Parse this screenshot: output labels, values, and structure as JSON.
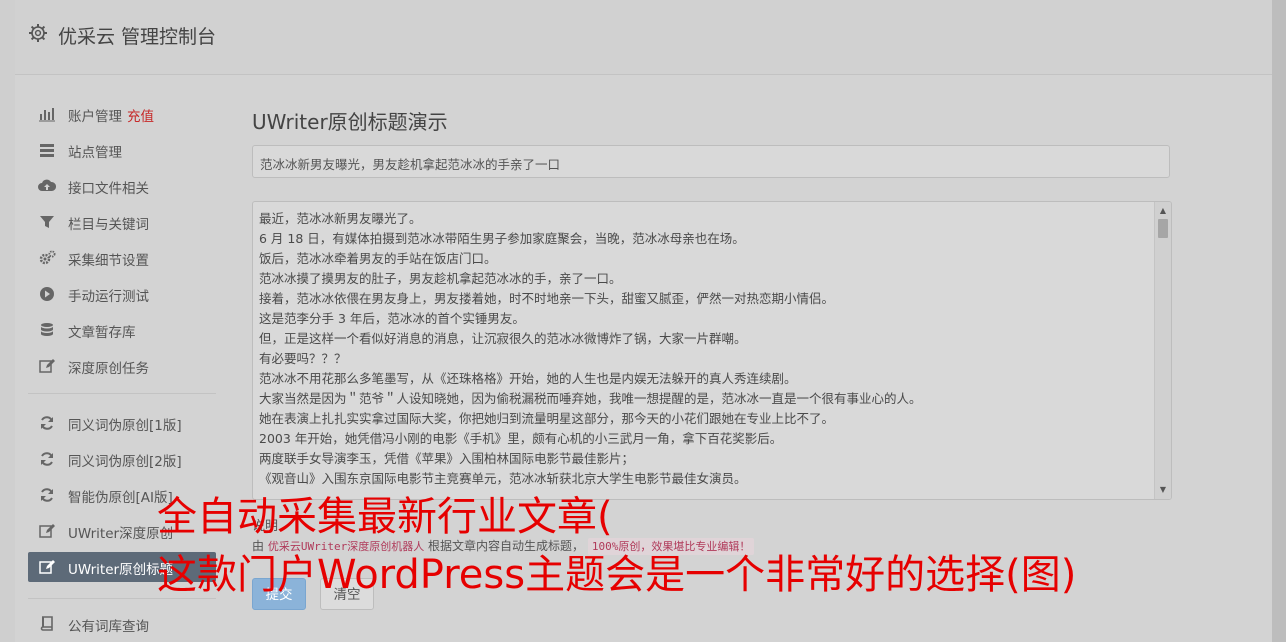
{
  "header": {
    "title": "优采云 管理控制台",
    "icon": "gear-icon"
  },
  "sidebar": {
    "items": [
      {
        "label": "账户管理",
        "extra": "充值",
        "icon": "bar-chart-icon"
      },
      {
        "label": "站点管理",
        "icon": "server-icon"
      },
      {
        "label": "接口文件相关",
        "icon": "cloud-upload-icon"
      },
      {
        "label": "栏目与关键词",
        "icon": "filter-icon"
      },
      {
        "label": "采集细节设置",
        "icon": "gears-icon"
      },
      {
        "label": "手动运行测试",
        "icon": "play-circle-icon"
      },
      {
        "label": "文章暂存库",
        "icon": "database-icon"
      },
      {
        "label": "深度原创任务",
        "icon": "edit-icon"
      },
      {
        "label": "同义词伪原创[1版]",
        "icon": "refresh-icon"
      },
      {
        "label": "同义词伪原创[2版]",
        "icon": "refresh-icon"
      },
      {
        "label": "智能伪原创[AI版]",
        "icon": "refresh-icon"
      },
      {
        "label": "UWriter深度原创",
        "icon": "edit-icon"
      },
      {
        "label": "UWriter原创标题",
        "icon": "edit-icon",
        "active": true
      },
      {
        "label": "公有词库查询",
        "icon": "book-icon"
      }
    ]
  },
  "main": {
    "title": "UWriter原创标题演示",
    "title_input_value": "范冰冰新男友曝光，男友趁机拿起范冰冰的手亲了一口",
    "content_lines": [
      "最近，范冰冰新男友曝光了。",
      "6 月 18 日，有媒体拍摄到范冰冰带陌生男子参加家庭聚会，当晚，范冰冰母亲也在场。",
      "饭后，范冰冰牵着男友的手站在饭店门口。",
      "范冰冰摸了摸男友的肚子，男友趁机拿起范冰冰的手，亲了一口。",
      "接着，范冰冰依偎在男友身上，男友搂着她，时不时地亲一下头，甜蜜又腻歪，俨然一对热恋期小情侣。",
      "这是范李分手 3 年后，范冰冰的首个实锤男友。",
      "但，正是这样一个看似好消息的消息，让沉寂很久的范冰冰微博炸了锅，大家一片群嘲。",
      "有必要吗？？？",
      "范冰冰不用花那么多笔墨写，从《还珠格格》开始，她的人生也是内娱无法躲开的真人秀连续剧。",
      "大家当然是因为＂范爷＂人设知晓她，因为偷税漏税而唾弃她，我唯一想提醒的是，范冰冰一直是一个很有事业心的人。",
      "她在表演上扎扎实实拿过国际大奖，你把她归到流量明星这部分，那今天的小花们跟她在专业上比不了。",
      "2003 年开始，她凭借冯小刚的电影《手机》里，颇有心机的小三武月一角，拿下百花奖影后。",
      "两度联手女导演李玉，凭借《苹果》入围柏林国际电影节最佳影片；",
      "《观音山》入围东京国际电影节主竞赛单元，范冰冰斩获北京大学生电影节最佳女演员。"
    ],
    "desc_label": "说明",
    "note_prefix": "由",
    "note_link": "优采云UWriter深度原创机器人",
    "note_middle": "根据文章内容自动生成标题，",
    "note_badge": "100%原创，效果堪比专业编辑！",
    "submit_label": "提交",
    "clear_label": "清空"
  },
  "overlay": {
    "line1": "全自动采集最新行业文章(",
    "line2": "这款门户WordPress主题会是一个非常好的选择(图)"
  }
}
